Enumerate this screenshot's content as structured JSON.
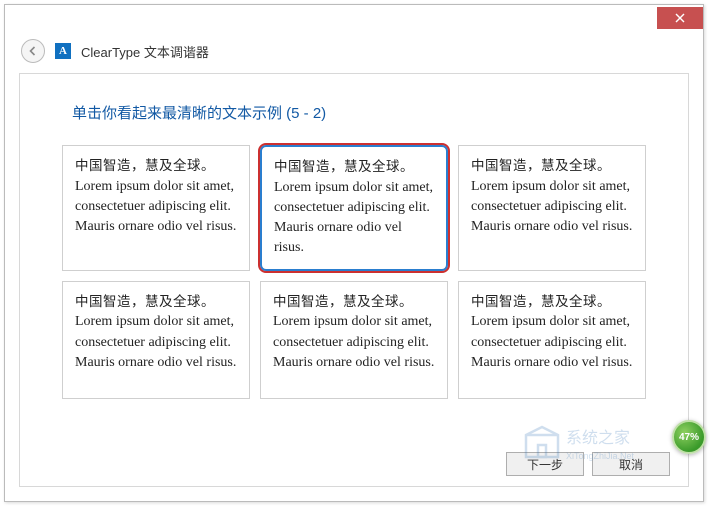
{
  "window": {
    "title": "ClearType 文本调谐器",
    "app_icon_letter": "A"
  },
  "instruction": "单击你看起来最清晰的文本示例 (5 - 2)",
  "sample_text": {
    "cn": "中国智造，慧及全球。",
    "en": "Lorem ipsum dolor sit amet, consectetuer adipiscing elit. Mauris ornare odio vel risus."
  },
  "samples": [
    {
      "selected": false
    },
    {
      "selected": true
    },
    {
      "selected": false
    },
    {
      "selected": false
    },
    {
      "selected": false
    },
    {
      "selected": false
    }
  ],
  "buttons": {
    "next": "下一步",
    "cancel": "取消"
  },
  "progress_percent": "47%",
  "watermark_text": "系统之家"
}
